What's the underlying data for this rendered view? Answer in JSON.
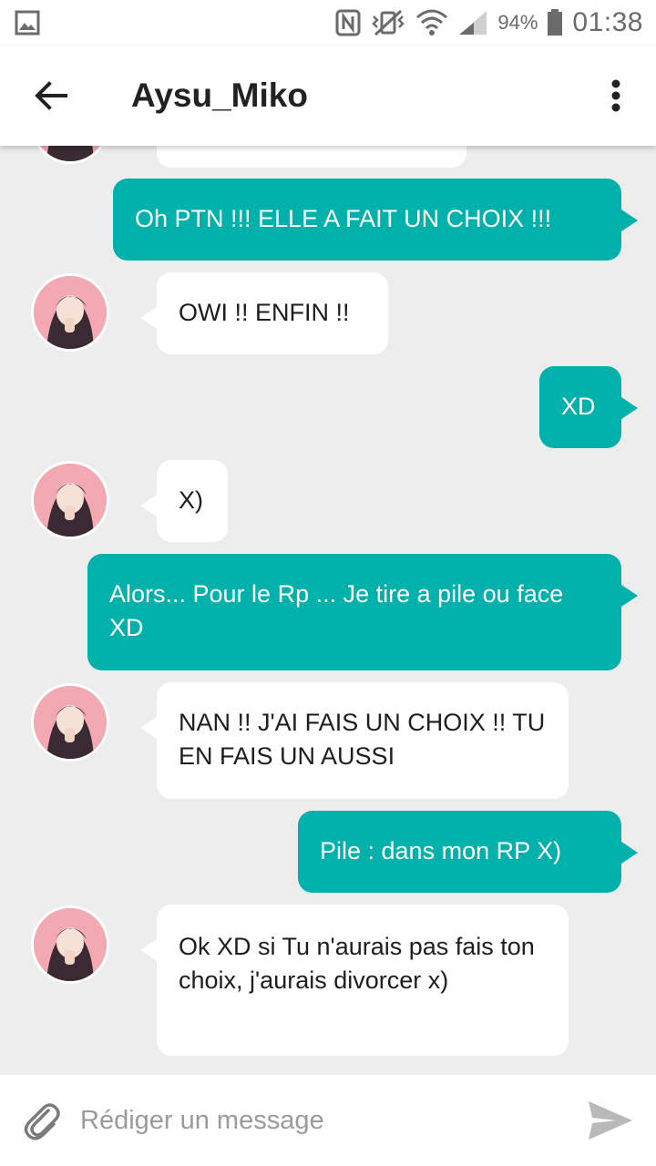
{
  "status_bar": {
    "battery_percent": "94%",
    "time": "01:38",
    "icons": [
      "gallery-icon",
      "nfc-icon",
      "vibrate-icon",
      "wifi-icon",
      "signal-icon",
      "battery-icon"
    ]
  },
  "header": {
    "title": "Aysu_Miko",
    "back_icon": "arrow-left-icon",
    "menu_icon": "more-vert-icon"
  },
  "messages": [
    {
      "direction": "in",
      "text": ""
    },
    {
      "direction": "out",
      "text": "Oh PTN !!! ELLE A FAIT UN CHOIX !!!"
    },
    {
      "direction": "in",
      "text": "OWI !! ENFIN !!"
    },
    {
      "direction": "out",
      "text": "XD"
    },
    {
      "direction": "in",
      "text": "X)"
    },
    {
      "direction": "out",
      "text": "Alors... Pour le Rp ... Je tire a pile ou face XD"
    },
    {
      "direction": "in",
      "text": "NAN !! J'AI FAIS UN CHOIX !! TU EN FAIS UN AUSSI"
    },
    {
      "direction": "out",
      "text": "Pile : dans mon RP X)"
    },
    {
      "direction": "in",
      "text": "Ok XD si Tu n'aurais pas fais ton choix, j'aurais divorcer x)"
    }
  ],
  "composer": {
    "placeholder": "Rédiger un message",
    "attach_icon": "paperclip-icon",
    "send_icon": "send-icon"
  },
  "colors": {
    "outgoing_bubble": "#00b0ab",
    "incoming_bubble": "#ffffff",
    "background": "#ededed"
  }
}
